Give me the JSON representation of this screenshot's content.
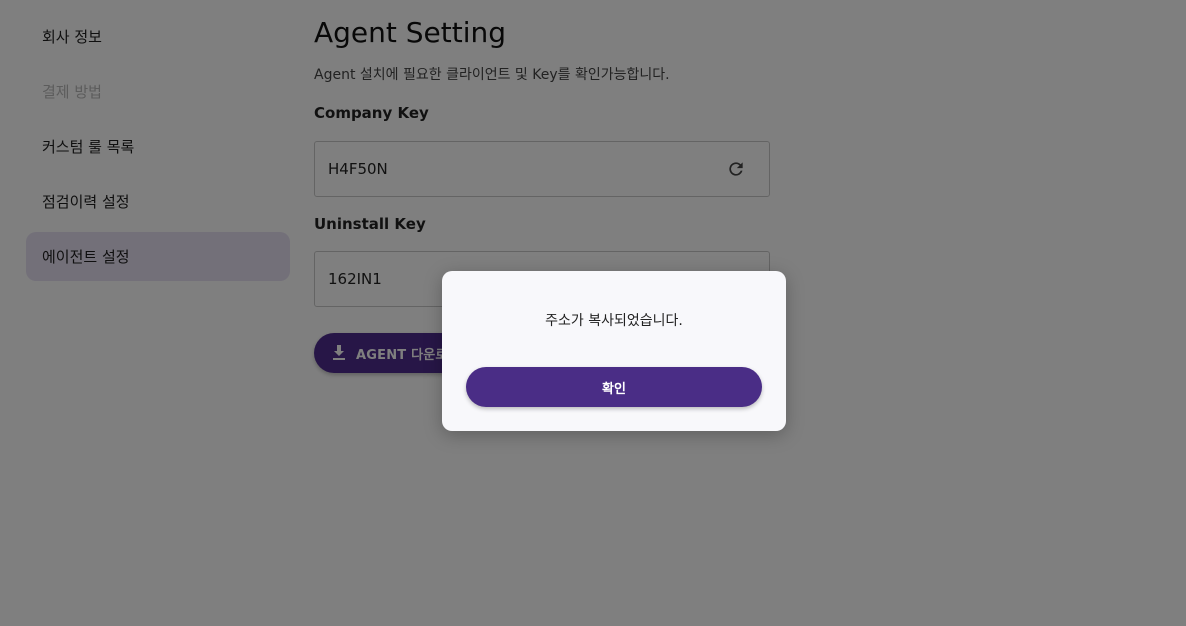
{
  "sidebar": {
    "items": [
      {
        "label": "회사 정보"
      },
      {
        "label": "결제 방법"
      },
      {
        "label": "커스텀 룰 목록"
      },
      {
        "label": "점검이력 설정"
      },
      {
        "label": "에이전트 설정"
      }
    ]
  },
  "main": {
    "title": "Agent Setting",
    "description": "Agent 설치에 필요한 클라이언트 및 Key를 확인가능합니다.",
    "company_key_label": "Company Key",
    "company_key_value": "H4F50N",
    "uninstall_key_label": "Uninstall Key",
    "uninstall_key_value": "162IN1",
    "download_button_label": "AGENT 다운로드"
  },
  "modal": {
    "message": "주소가 복사되었습니다.",
    "confirm_label": "확인"
  },
  "colors": {
    "accent": "#4a2d86",
    "active_sidebar_bg": "#e6e0f3",
    "overlay": "rgba(0,0,0,0.5)"
  },
  "icons": {
    "refresh": "refresh-icon",
    "download": "download-icon"
  }
}
